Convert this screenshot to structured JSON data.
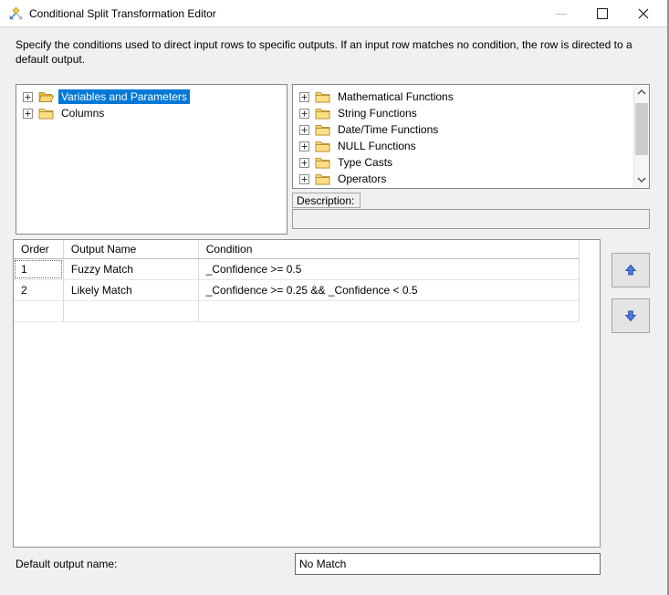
{
  "window": {
    "title": "Conditional Split Transformation Editor"
  },
  "icons": {
    "app": "split-branch",
    "minimize": "dash",
    "maximize": "square-outline",
    "close": "x",
    "tree_expander": "plus-box",
    "folder_open": "gold-open-folder",
    "folder_closed": "gold-folder",
    "scroll_up": "chevron-up",
    "scroll_down": "chevron-down",
    "move_up": "blue-up-arrow",
    "move_down": "blue-down-arrow"
  },
  "instructions": "Specify the conditions used to direct input rows to specific outputs. If an input row matches no condition, the row is directed to a default output.",
  "left_tree": {
    "items": [
      {
        "label": "Variables and Parameters",
        "selected": true,
        "folder": "open"
      },
      {
        "label": "Columns",
        "selected": false,
        "folder": "closed"
      }
    ]
  },
  "right_tree": {
    "items": [
      {
        "label": "Mathematical Functions"
      },
      {
        "label": "String Functions"
      },
      {
        "label": "Date/Time Functions"
      },
      {
        "label": "NULL Functions"
      },
      {
        "label": "Type Casts"
      },
      {
        "label": "Operators"
      }
    ]
  },
  "description": {
    "label": "Description:",
    "value": ""
  },
  "grid": {
    "columns": [
      "Order",
      "Output Name",
      "Condition"
    ],
    "rows": [
      {
        "order": "1",
        "output_name": "Fuzzy Match",
        "condition": "_Confidence >= 0.5"
      },
      {
        "order": "2",
        "output_name": "Likely Match",
        "condition": "_Confidence >= 0.25 && _Confidence < 0.5"
      },
      {
        "order": "",
        "output_name": "",
        "condition": ""
      }
    ]
  },
  "default_output": {
    "label": "Default output name:",
    "value": "No Match"
  },
  "colors": {
    "selection_blue": "#0078d7",
    "arrow_blue": "#4a7de0",
    "dialog_background": "#f0f0f0"
  }
}
